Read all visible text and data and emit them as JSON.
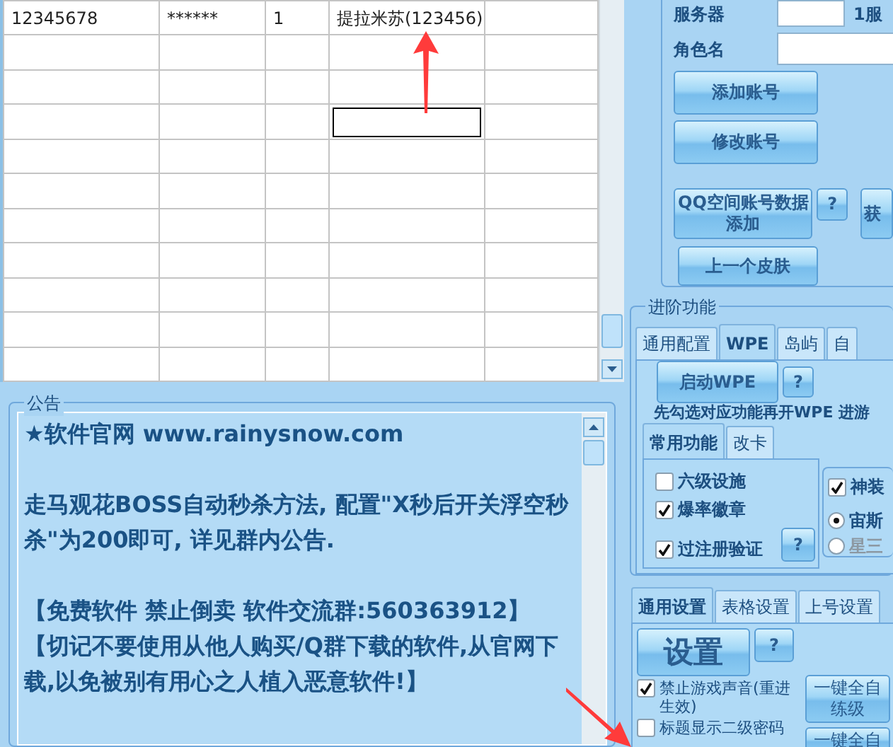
{
  "table": {
    "rows": [
      {
        "cells": [
          "12345678",
          "******",
          "1",
          "提拉米苏(123456)"
        ]
      }
    ],
    "editor": {
      "visible": true
    }
  },
  "notice": {
    "title": "公告",
    "blocks": [
      {
        "paragraphs": [
          "★软件官网 www.rainysnow.com"
        ]
      },
      {
        "paragraphs": [
          "走马观花BOSS自动秒杀方法, 配置\"X秒后开关浮空秒杀\"为200即可, 详见群内公告."
        ]
      },
      {
        "paragraphs": [
          "【免费软件 禁止倒卖 软件交流群:560363912】",
          "【切记不要使用从他人购买/Q群下载的软件,从官网下载,以免被别有用心之人植入恶意软件!】"
        ]
      }
    ]
  },
  "account": {
    "fields": [
      {
        "label": "服务器",
        "note": "1服"
      },
      {
        "label": "角色名"
      }
    ],
    "buttons": [
      {
        "label": "添加账号"
      },
      {
        "label": "修改账号"
      }
    ],
    "qq_button": {
      "lines": [
        "QQ空间账号数据",
        "添加"
      ]
    },
    "qq_help": "?",
    "side_button": "获",
    "skin_button": "上一个皮肤"
  },
  "advanced": {
    "title": "进阶功能",
    "tabs": [
      {
        "label": "通用配置",
        "selected": false
      },
      {
        "label": "WPE",
        "selected": true
      },
      {
        "label": "岛屿",
        "selected": false
      },
      {
        "label": "自",
        "selected": false
      }
    ],
    "start_button": "启动WPE",
    "help_button": "?",
    "hint": "先勾选对应功能再开WPE 进游",
    "sub_tabs": [
      {
        "label": "常用功能",
        "selected": true
      },
      {
        "label": "改卡",
        "selected": false
      }
    ],
    "options": [
      {
        "label": "六级设施",
        "checked": false
      },
      {
        "label": "爆率徽章",
        "checked": true
      },
      {
        "label": "过注册验证",
        "checked": true
      }
    ],
    "options_help": "?",
    "right_options": [
      {
        "kind": "checkbox",
        "label": "神装",
        "checked": true
      },
      {
        "kind": "radio",
        "label": "宙斯",
        "selected": true
      },
      {
        "kind": "radio",
        "label": "星三",
        "selected": false
      }
    ]
  },
  "settings": {
    "tabs": [
      {
        "label": "通用设置",
        "selected": true
      },
      {
        "label": "表格设置",
        "selected": false
      },
      {
        "label": "上号设置",
        "selected": false
      }
    ],
    "settings_button": "设置",
    "help_button": "?",
    "options": [
      {
        "label": "禁止游戏声音(重进生效)",
        "checked": true
      },
      {
        "label": "标题显示二级密码",
        "checked": false
      }
    ],
    "auto_buttons": [
      {
        "lines": [
          "一键全自",
          "练级"
        ]
      },
      {
        "lines": [
          "一键全自"
        ]
      }
    ]
  }
}
